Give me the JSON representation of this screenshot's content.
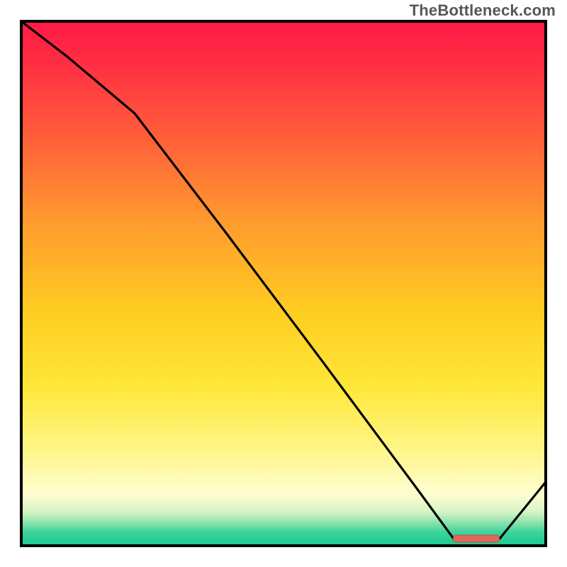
{
  "watermark": "TheBottleneck.com",
  "chart_data": {
    "type": "line",
    "title": "",
    "xlabel": "",
    "ylabel": "",
    "xlim": [
      30,
      770
    ],
    "ylim": [
      770,
      30
    ],
    "x": [
      30,
      95,
      190,
      320,
      455,
      585,
      640,
      705,
      770
    ],
    "values": [
      30,
      80,
      160,
      330,
      510,
      685,
      760,
      760,
      680
    ],
    "marker": {
      "x": 672,
      "y": 760,
      "w": 65,
      "h": 10
    },
    "gradient_stops": [
      {
        "offset": 0.0,
        "color": "#ff1a46"
      },
      {
        "offset": 0.08,
        "color": "#ff2e43"
      },
      {
        "offset": 0.22,
        "color": "#ff5e3a"
      },
      {
        "offset": 0.38,
        "color": "#ff9a2e"
      },
      {
        "offset": 0.55,
        "color": "#ffcc21"
      },
      {
        "offset": 0.7,
        "color": "#ffe83a"
      },
      {
        "offset": 0.82,
        "color": "#fff68a"
      },
      {
        "offset": 0.9,
        "color": "#fffdd0"
      },
      {
        "offset": 0.935,
        "color": "#d8f4c6"
      },
      {
        "offset": 0.955,
        "color": "#8fe3ae"
      },
      {
        "offset": 0.975,
        "color": "#3bd39a"
      },
      {
        "offset": 1.0,
        "color": "#18c98f"
      }
    ],
    "border_color": "#000000",
    "line_color": "#000000",
    "marker_fill": "#e1675b",
    "marker_stroke": "#c24d41"
  }
}
